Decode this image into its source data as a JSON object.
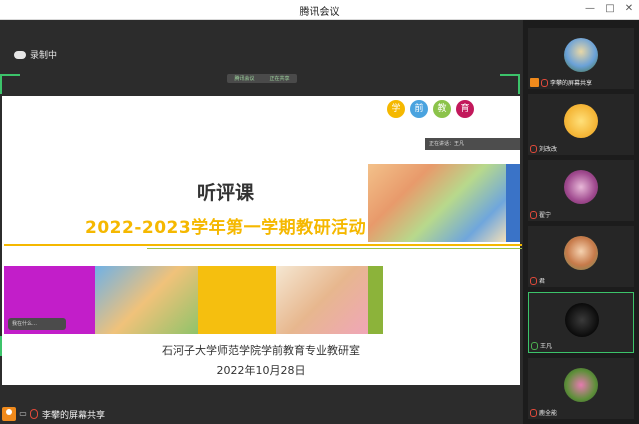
{
  "app": {
    "title": "腾讯会议"
  },
  "window_controls": {
    "minimize": "—",
    "maximize": "□",
    "close": "✕"
  },
  "recording": {
    "label": "录制中"
  },
  "share_pill": {
    "left": "腾讯会议",
    "right": "正在共享"
  },
  "slide": {
    "circles": [
      {
        "char": "学",
        "color": "#f5b800"
      },
      {
        "char": "前",
        "color": "#4aa3df"
      },
      {
        "char": "教",
        "color": "#8bc34a"
      },
      {
        "char": "育",
        "color": "#c2185b"
      }
    ],
    "speaking": "正在讲话：王凡",
    "title": "听评课",
    "subtitle": "2022-2023学年第一学期教研活动",
    "chip": "我在什么…",
    "organization": "石河子大学师范学院学前教育专业教研室",
    "date": "2022年10月28日",
    "colors": {
      "accent_yellow": "#f5b800",
      "accent_green": "#9dc44a",
      "blue": "#3a73c7",
      "magenta": "#c21ec9"
    }
  },
  "bottom_bar": {
    "label": "李攀的屏幕共享"
  },
  "participants": [
    {
      "name": "李攀的屏幕共享",
      "avatar": "landscape-avatar",
      "sharing": true
    },
    {
      "name": "刘改改",
      "avatar": "emoji-avatar"
    },
    {
      "name": "翟宁",
      "avatar": "flower-avatar"
    },
    {
      "name": "君",
      "avatar": "cartoon-avatar"
    },
    {
      "name": "王凡",
      "avatar": "dark-avatar",
      "active": true
    },
    {
      "name": "鹿全能",
      "avatar": "plant-avatar"
    }
  ]
}
